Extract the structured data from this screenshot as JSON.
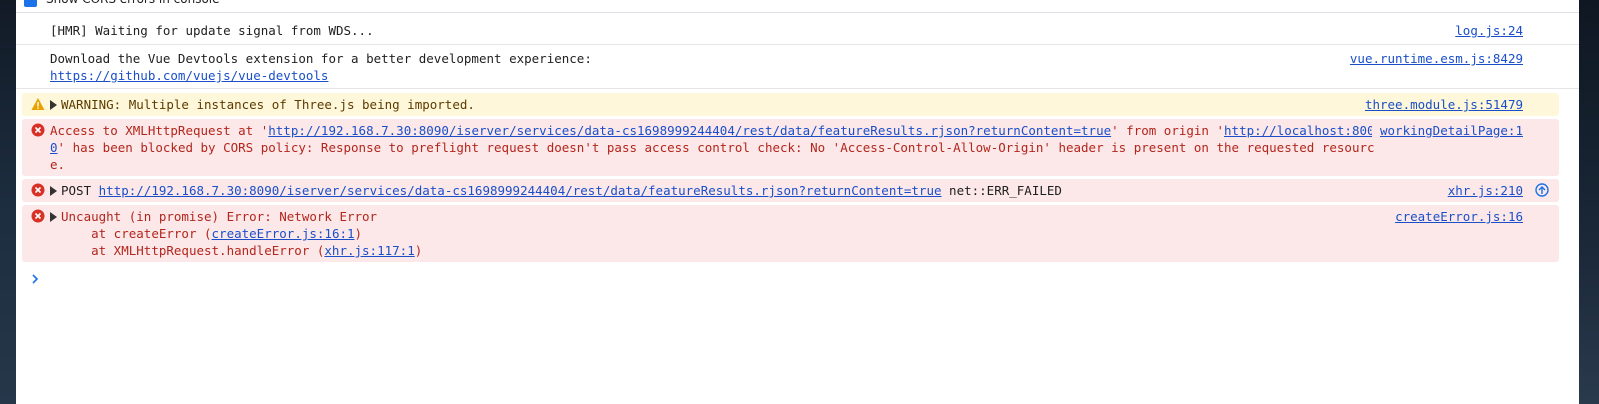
{
  "top": {
    "label": "Show CORS errors in console"
  },
  "messages": {
    "hmr": {
      "text": "[HMR] Waiting for update signal from WDS...",
      "source": "log.js:24"
    },
    "vue": {
      "text": "Download the Vue Devtools extension for a better development experience:",
      "link": "https://github.com/vuejs/vue-devtools",
      "source": "vue.runtime.esm.js:8429"
    },
    "warn": {
      "text": "WARNING: Multiple instances of Three.js being imported.",
      "source": "three.module.js:51479"
    },
    "cors": {
      "p1": "Access to XMLHttpRequest at '",
      "url": "http://192.168.7.30:8090/iserver/services/data-cs1698999244404/rest/data/featureResults.rjson?returnContent=true",
      "p2": "' from origin '",
      "origin": "http://localhost:8000",
      "p3": "' has been blocked by CORS policy: Response to preflight request doesn't pass access control check: No 'Access-Control-Allow-Origin' header is present on the requested resource.",
      "source": "workingDetailPage:1"
    },
    "post": {
      "method": "POST",
      "url": "http://192.168.7.30:8090/iserver/services/data-cs1698999244404/rest/data/featureResults.rjson?returnContent=true",
      "status": "net::ERR_FAILED",
      "source": "xhr.js:210"
    },
    "uncaught": {
      "text": "Uncaught (in promise) Error: Network Error",
      "frame1_pre": "    at createError (",
      "frame1_link": "createError.js:16:1",
      "frame1_post": ")",
      "frame2_pre": "    at XMLHttpRequest.handleError (",
      "frame2_link": "xhr.js:117:1",
      "frame2_post": ")",
      "source": "createError.js:16"
    }
  },
  "colors": {
    "link": "#1a4fc9",
    "error_bg": "#fce8e8",
    "warn_bg": "#fef7d9",
    "error_icon": "#d93025",
    "warn_icon": "#e8a200"
  }
}
